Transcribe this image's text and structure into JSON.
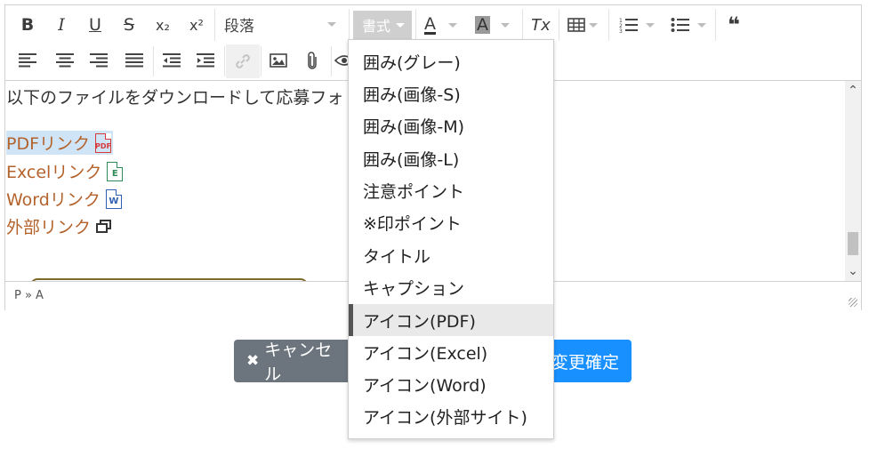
{
  "toolbar": {
    "bold": "B",
    "italic": "I",
    "underline": "U",
    "strike": "S",
    "subscript": "x₂",
    "superscript": "x²",
    "paragraph_format": "段落",
    "styles": "書式",
    "text_color": "A",
    "bg_color": "A",
    "remove_format": "Tx",
    "blockquote": "❝"
  },
  "content": {
    "intro": "以下のファイルをダウンロードして応募フォ",
    "links": [
      {
        "text": "PDFリンク",
        "icon": "pdf-file-icon",
        "icon_label": "PDF",
        "color": "#d63a3a"
      },
      {
        "text": "Excelリンク",
        "icon": "excel-file-icon",
        "icon_label": "E",
        "color": "#2e8b57"
      },
      {
        "text": "Wordリンク",
        "icon": "word-file-icon",
        "icon_label": "W",
        "color": "#2f5fb3"
      },
      {
        "text": "外部リンク",
        "icon": "external-window-icon"
      }
    ]
  },
  "status": {
    "path": "P » A"
  },
  "buttons": {
    "cancel": "キャンセル",
    "confirm": "変更確定",
    "cancel_icon": "✖"
  },
  "dropdown": {
    "items": [
      "囲み(グレー)",
      "囲み(画像-S)",
      "囲み(画像-M)",
      "囲み(画像-L)",
      "注意ポイント",
      "※印ポイント",
      "タイトル",
      "キャプション",
      "アイコン(PDF)",
      "アイコン(Excel)",
      "アイコン(Word)",
      "アイコン(外部サイト)"
    ],
    "selected_index": 8
  },
  "colors": {
    "link": "#b4622c",
    "cancel": "#6c757d",
    "confirm": "#1890ff"
  }
}
